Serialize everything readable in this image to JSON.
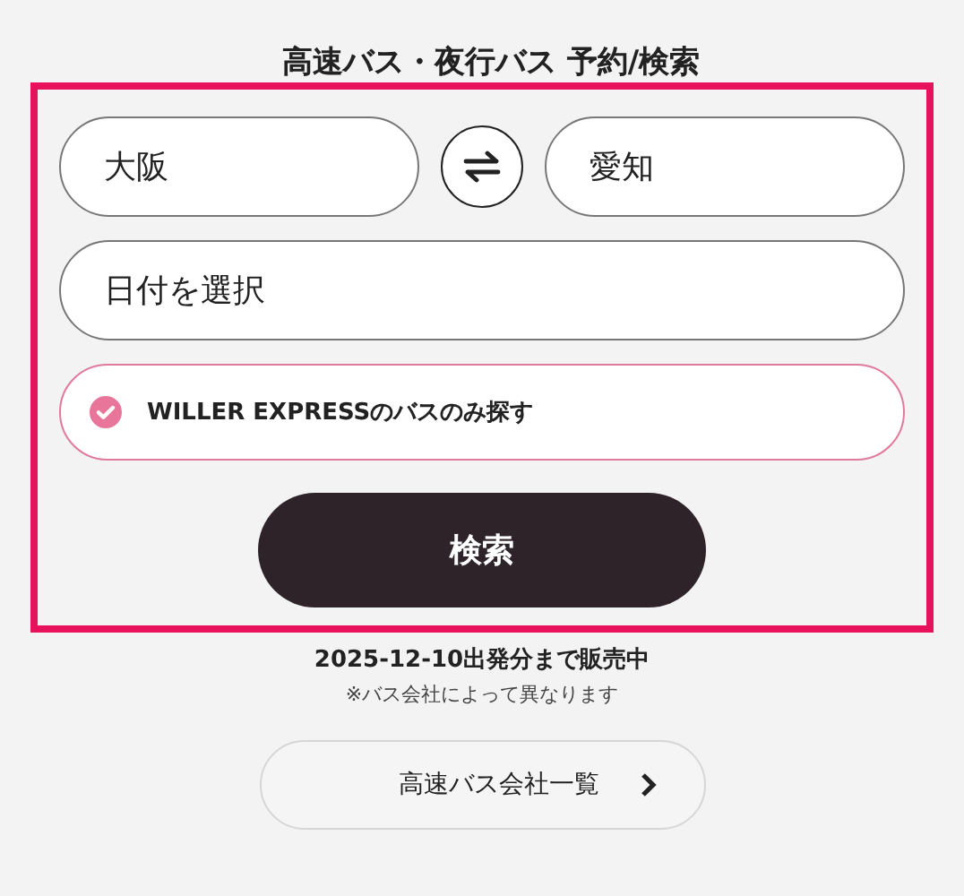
{
  "title": "高速バス・夜行バス 予約/検索",
  "from": {
    "value": "大阪"
  },
  "to": {
    "value": "愛知"
  },
  "date": {
    "placeholder": "日付を選択"
  },
  "willer_only": {
    "label": "WILLER EXPRESSのバスのみ探す",
    "checked": true
  },
  "search_button": "検索",
  "sale_notice": "2025-12-10出発分まで販売中",
  "sale_note": "※バス会社によって異なります",
  "company_list_button": "高速バス会社一覧"
}
